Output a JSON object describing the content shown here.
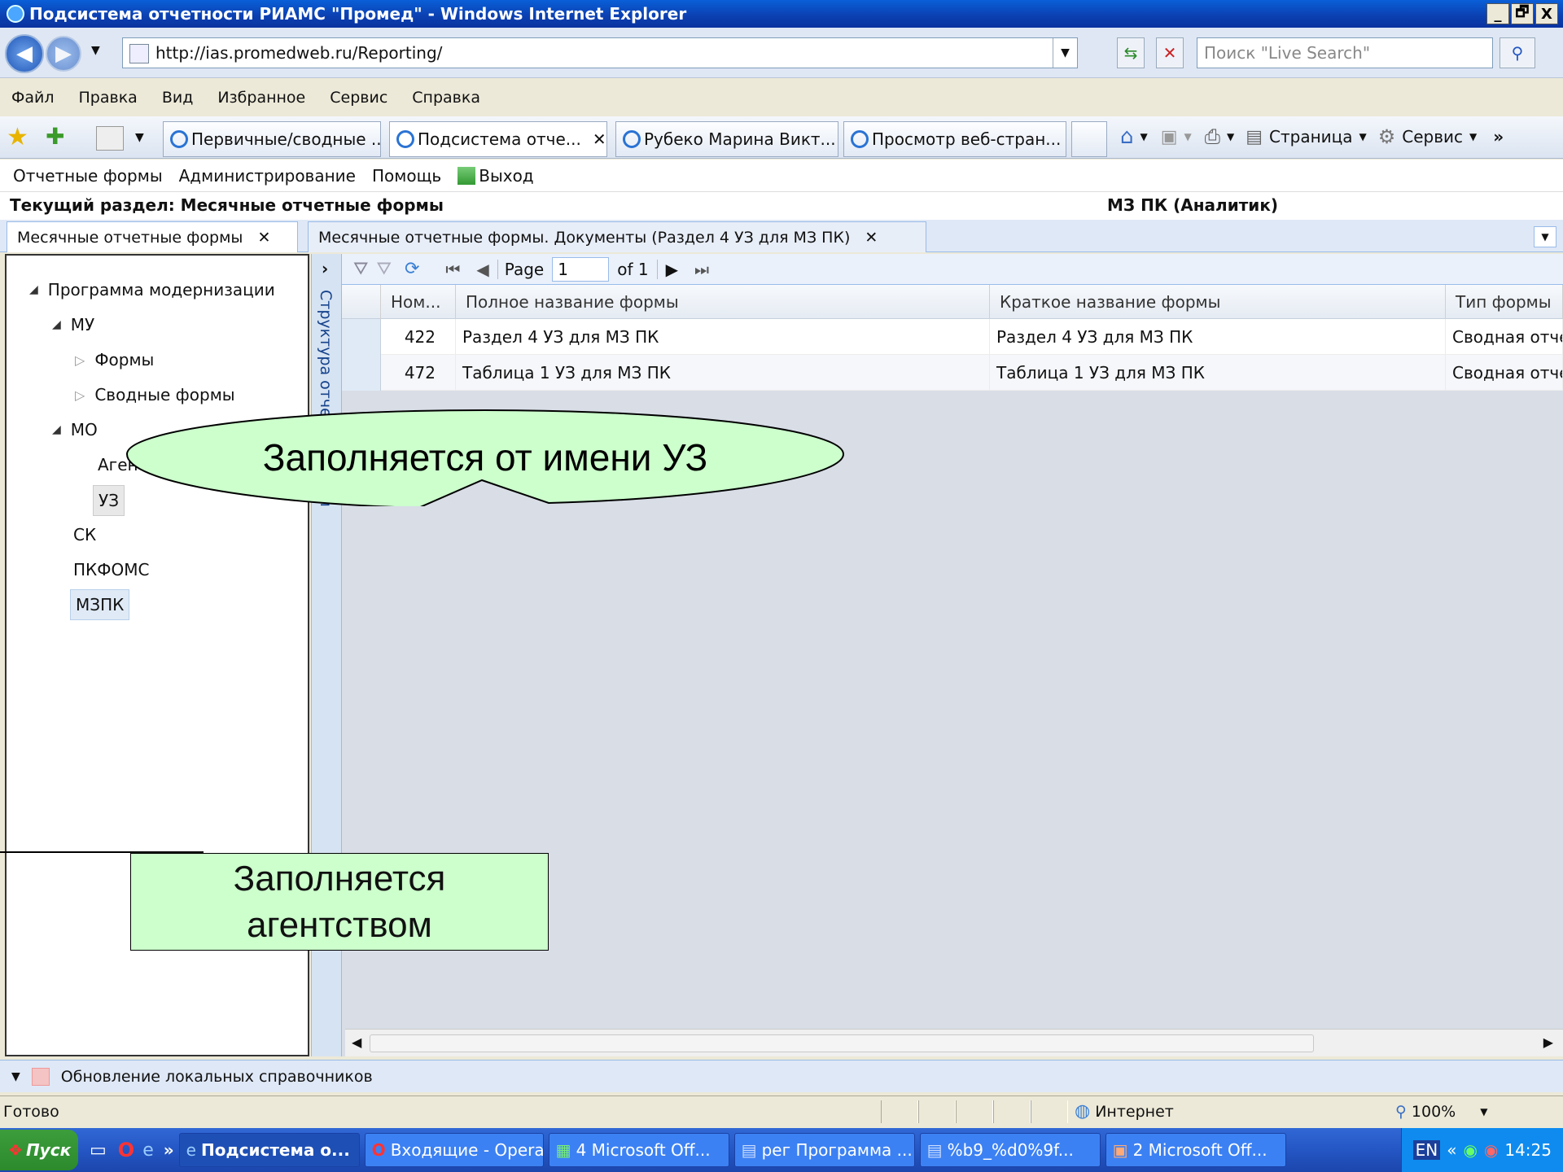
{
  "window": {
    "title": "Подсистема отчетности РИАМС \"Промед\" - Windows Internet Explorer",
    "buttons": [
      "_",
      "🗗",
      "X"
    ]
  },
  "address": {
    "url": "http://ias.promedweb.ru/Reporting/",
    "search_placeholder": "Поиск \"Live Search\""
  },
  "menu": [
    "Файл",
    "Правка",
    "Вид",
    "Избранное",
    "Сервис",
    "Справка"
  ],
  "ie_tabs": [
    "Первичные/сводные ...",
    "Подсистема отче...",
    "Рубеко Марина Викт...",
    "Просмотр веб-стран..."
  ],
  "ie_tools": {
    "page": "Страница",
    "service": "Сервис"
  },
  "app_menu": {
    "forms": "Отчетные формы",
    "admin": "Администрирование",
    "help": "Помощь",
    "exit": "Выход"
  },
  "section": {
    "current": "Текущий раздел: Месячные отчетные формы",
    "user": "МЗ ПК (Аналитик)"
  },
  "app_tabs": [
    "Месячные отчетные формы",
    "Месячные отчетные формы. Документы (Раздел 4 УЗ для МЗ ПК)"
  ],
  "tree": {
    "root": "Программа модернизации",
    "mu": "МУ",
    "forms": "Формы",
    "summary_forms": "Сводные формы",
    "mo": "МО",
    "agency": "Агенство",
    "uz": "УЗ",
    "sk": "СК",
    "pkfoms": "ПКФОМС",
    "mzpk": "МЗПК"
  },
  "side_panel_label": "Структура отчетных форм",
  "pager": {
    "page_label": "Page",
    "page_value": "1",
    "of_label": "of 1"
  },
  "grid": {
    "headers": [
      "Ном...",
      "Полное название формы",
      "Краткое название формы",
      "Тип формы"
    ],
    "rows": [
      {
        "num": "422",
        "full": "Раздел 4 УЗ для МЗ ПК",
        "short": "Раздел 4 УЗ для МЗ ПК",
        "type": "Сводная отчетная форма"
      },
      {
        "num": "472",
        "full": "Таблица 1 УЗ для МЗ ПК",
        "short": "Таблица 1 УЗ для МЗ ПК",
        "type": "Сводная отчетная форма"
      }
    ]
  },
  "bottom_panel": "Обновление локальных справочников",
  "status": {
    "left": "Готово",
    "zone": "Интернет",
    "zoom": "100%"
  },
  "taskbar": {
    "start": "Пуск",
    "tasks": [
      "Подсистема о...",
      "Входящие - Opera",
      "4 Microsoft Off...",
      "рег Программа ...",
      "%b9_%d0%9f...",
      "2 Microsoft Off..."
    ],
    "lang": "EN",
    "clock": "14:25"
  },
  "callouts": {
    "bubble": "Заполняется от имени УЗ",
    "box_line1": "Заполняется",
    "box_line2": "агентством"
  },
  "colors": {
    "callout_fill": "#ccffcc",
    "titlebar": "#0a4fc8",
    "grid_header": "#e5ebf3"
  }
}
